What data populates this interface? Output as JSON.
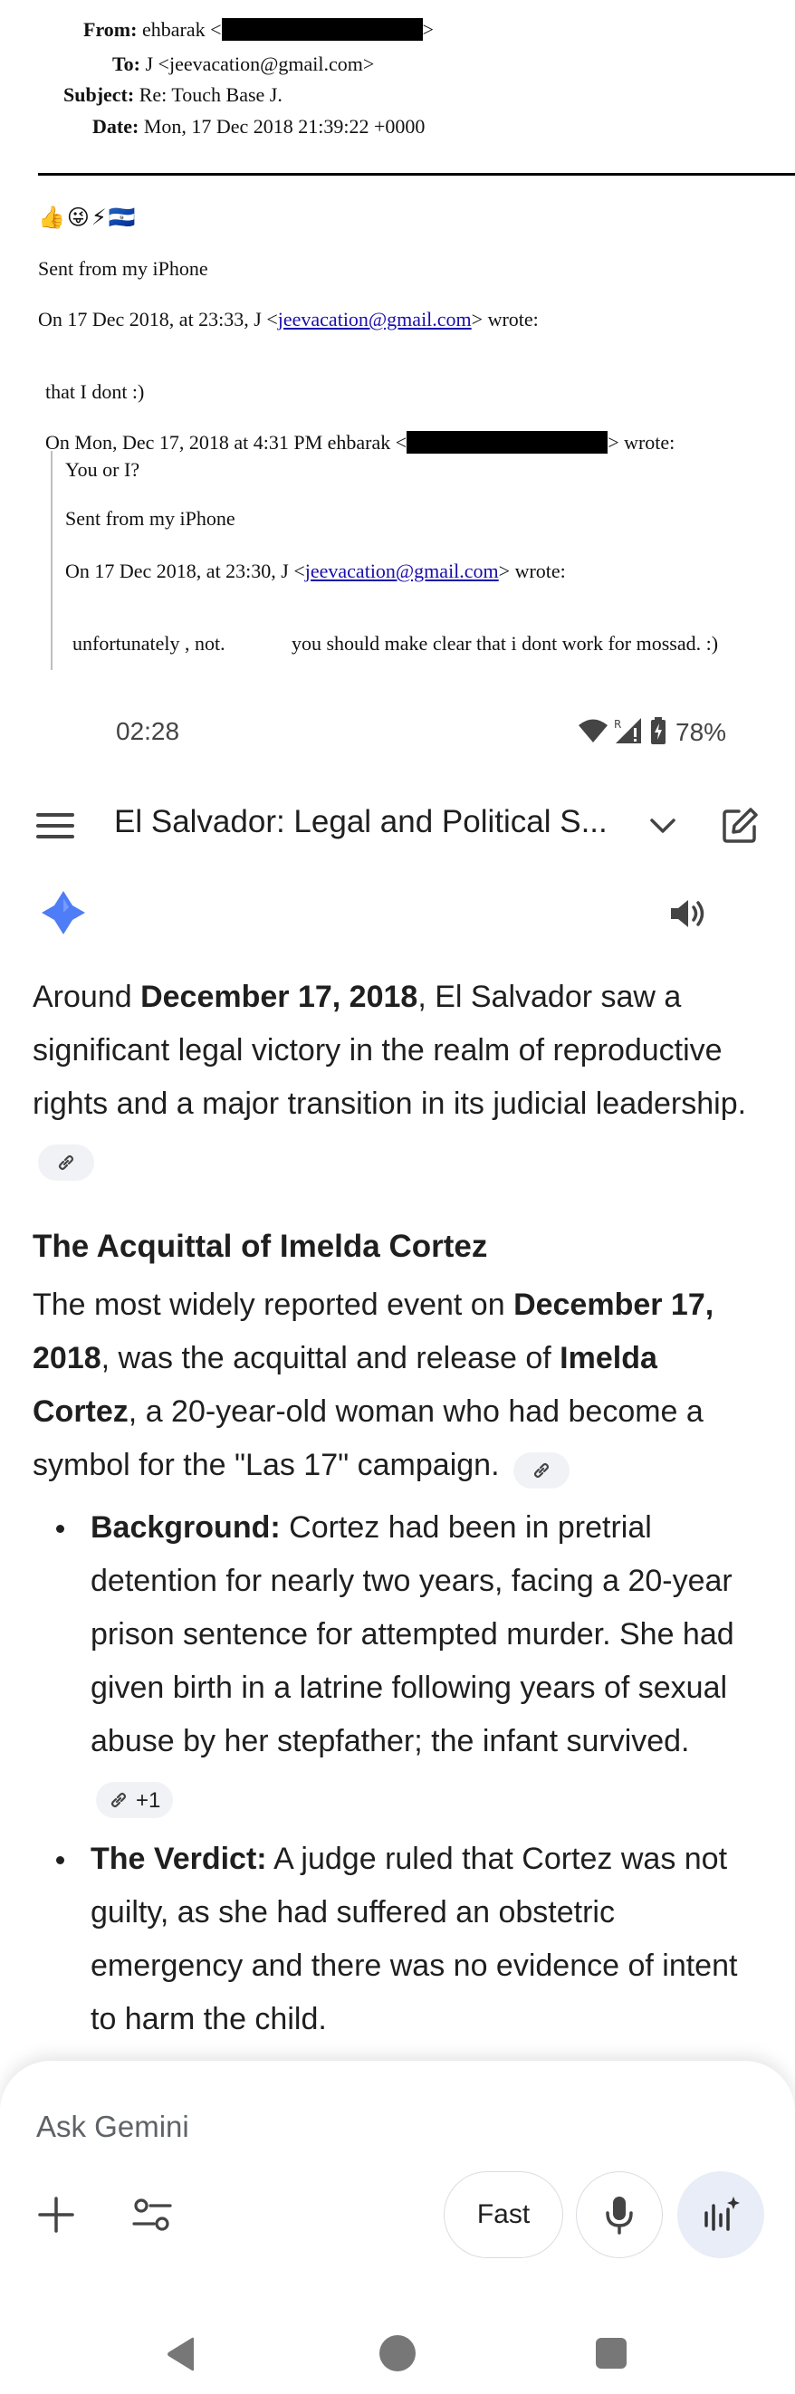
{
  "email": {
    "from_label": "From:",
    "from_value": "ehbarak <",
    "from_close": ">",
    "to_label": "To:",
    "to_value": "J <jeevacation@gmail.com>",
    "subject_label": "Subject:",
    "subject_value": "Re: Touch Base J.",
    "date_label": "Date:",
    "date_value": "Mon, 17 Dec 2018 21:39:22 +0000",
    "emoji_line": "👍😜⚡🇸🇻",
    "sent_from": "Sent from my iPhone",
    "quote1_pre": "On 17 Dec 2018, at 23:33, J <",
    "quote1_link": "jeevacation@gmail.com",
    "quote1_post": "> wrote:",
    "reply1": "that I dont  :)",
    "quote2_pre": "On Mon, Dec 17, 2018 at 4:31 PM ehbarak <",
    "quote2_post": "> wrote:",
    "reply2": "You or I?",
    "sent_from_2": "Sent from my iPhone",
    "quote3_pre": "On 17 Dec 2018, at 23:30, J <",
    "quote3_link": "jeevacation@gmail.com",
    "quote3_post": "> wrote:",
    "reply3a": "unfortunately , not.",
    "reply3b": "you should make clear that i dont work for mossad. :)"
  },
  "status_bar": {
    "time": "02:28",
    "battery": "78%"
  },
  "app_bar": {
    "title": "El Salvador: Legal and Political S..."
  },
  "response": {
    "p1_pre": "Around ",
    "p1_bold": "December 17, 2018",
    "p1_post": ", El Salvador saw a significant legal victory in the realm of reproductive rights and a major transition in its judicial leadership.",
    "heading": "The Acquittal of Imelda Cortez",
    "p2_a": "The most widely reported event on ",
    "p2_b": "December 17, 2018",
    "p2_c": ", was the acquittal and release of ",
    "p2_d": "Imelda Cortez",
    "p2_e": ", a 20-year-old woman who had become a symbol for the \"Las 17\" campaign.",
    "bullets": [
      {
        "label": "Background:",
        "text": " Cortez had been in pretrial detention for nearly two years, facing a 20-year prison sentence for attempted murder. She had given birth in a latrine following years of sexual abuse by her stepfather; the infant survived.",
        "cite_extra": "+1"
      },
      {
        "label": "The Verdict:",
        "text": " A judge ruled that Cortez was not guilty, as she had suffered an obstetric emergency and there was no evidence of intent to harm the child."
      }
    ]
  },
  "composer": {
    "placeholder": "Ask Gemini",
    "mode_label": "Fast"
  },
  "colors": {
    "gemini_blue": "#4f7cf7",
    "chip_bg": "#f0f2f5",
    "live_bg": "#e8edf7"
  }
}
